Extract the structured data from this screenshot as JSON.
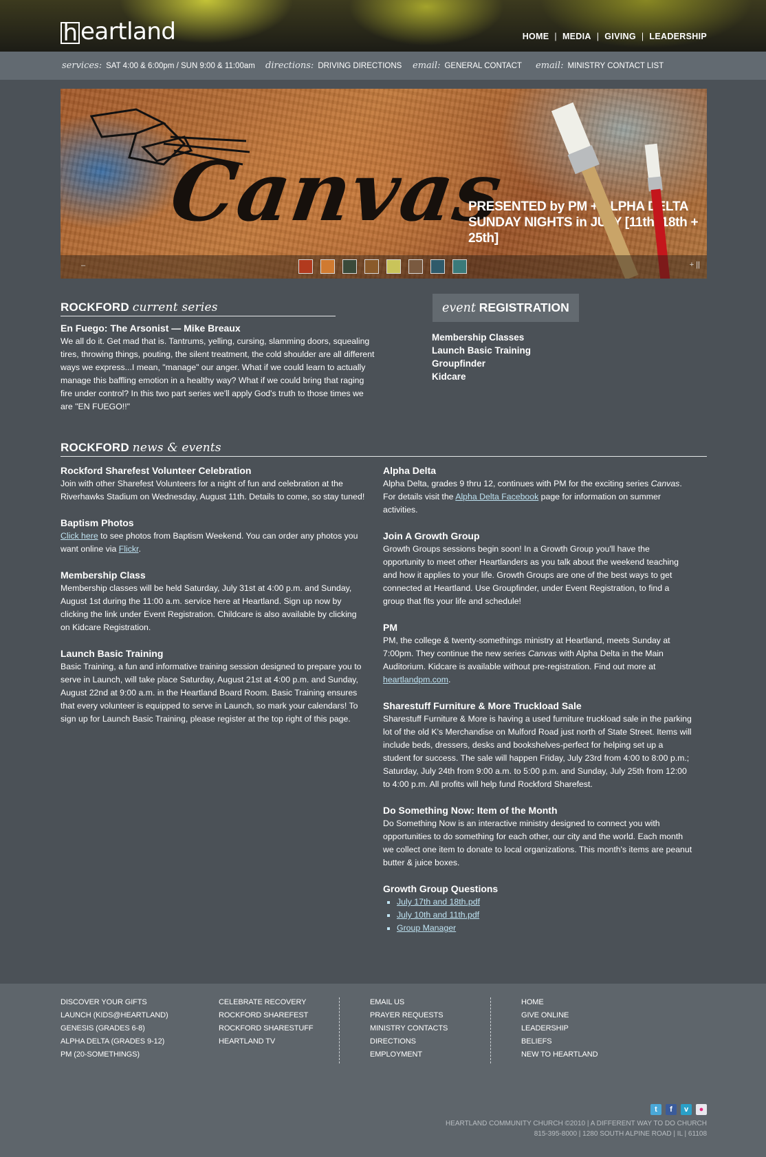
{
  "header": {
    "logo_text": "eartland",
    "logo_initial": "h",
    "nav": [
      "HOME",
      "MEDIA",
      "GIVING",
      "LEADERSHIP"
    ],
    "nav_separator": "|"
  },
  "infobar": {
    "services_label": "services:",
    "services_text": "SAT 4:00 & 6:00pm / SUN 9:00 & 11:00am",
    "directions_label": "directions:",
    "directions_text": "DRIVING DIRECTIONS",
    "email1_label": "email:",
    "email1_text": "GENERAL CONTACT",
    "email2_label": "email:",
    "email2_text": "MINISTRY CONTACT LIST"
  },
  "banner": {
    "title": "Canvas",
    "subtitle_line1": "PRESENTED by PM + ALPHA DELTA",
    "subtitle_line2": "SUNDAY NIGHTS in JULY [11th, 18th + 25th]",
    "thumb_colors": [
      "#b23a1e",
      "#d07a30",
      "#3a4a3a",
      "#8a5a2a",
      "#c9c45a",
      "#7a5a40",
      "#2f5a6a",
      "#3a7a7a"
    ],
    "prev_symbol": "–",
    "next_symbol": "+ ||"
  },
  "series": {
    "heading_bold": "ROCKFORD",
    "heading_script": "current series",
    "title": "En Fuego: The Arsonist — Mike Breaux",
    "body": "We all do it. Get mad that is. Tantrums, yelling, cursing, slamming doors, squealing tires, throwing things, pouting, the silent treatment, the cold shoulder are all different ways we express...I mean, \"manage\" our anger. What if we could learn to actually manage this baffling emotion in a healthy way? What if we could bring that raging fire under control? In this two part series we'll apply God's truth to those times we are \"EN FUEGO!!\""
  },
  "event": {
    "heading_script": "event",
    "heading_bold": "REGISTRATION",
    "links": [
      "Membership Classes",
      "Launch Basic Training",
      "Groupfinder",
      "Kidcare"
    ]
  },
  "news": {
    "heading_bold": "ROCKFORD",
    "heading_script": "news & events",
    "left": [
      {
        "title": "Rockford Sharefest Volunteer Celebration",
        "body": "Join with other Sharefest Volunteers for a night of fun and celebration at the Riverhawks Stadium on Wednesday, August 11th. Details to come, so stay tuned!"
      },
      {
        "title": "Baptism Photos",
        "link1": "Click here",
        "body_mid": " to see photos from Baptism Weekend. You can order any photos you want online via ",
        "link2": "Flickr",
        "body_end": "."
      },
      {
        "title": "Membership Class",
        "body": "Membership classes will be held Saturday, July 31st at 4:00 p.m. and Sunday, August 1st during the 11:00 a.m. service here at Heartland. Sign up now by clicking the link under Event Registration. Childcare is also available by clicking on Kidcare Registration."
      },
      {
        "title": "Launch Basic Training",
        "body": "Basic Training, a fun and informative training session designed to prepare you to serve in Launch, will take place Saturday, August 21st at 4:00 p.m. and Sunday, August 22nd at 9:00 a.m. in the Heartland Board Room. Basic Training ensures that every volunteer is equipped to serve in Launch, so mark your calendars! To sign up for Launch Basic Training, please register at the top right of this page."
      }
    ],
    "right": [
      {
        "title": "Alpha Delta",
        "body_start": "Alpha Delta, grades 9 thru 12, continues with PM for the exciting series ",
        "italic": "Canvas",
        "body_mid": ". For details visit the ",
        "link": "Alpha Delta Facebook",
        "body_end": " page for information on summer activities."
      },
      {
        "title": "Join A Growth Group",
        "body": "Growth Groups sessions begin soon! In a Growth Group you'll have the opportunity to meet other Heartlanders as you talk about the weekend teaching and how it applies to your life. Growth Groups are one of the best ways to get connected at Heartland. Use Groupfinder, under Event Registration, to find a group that fits your life and schedule!"
      },
      {
        "title": "PM",
        "body_start": "PM, the college & twenty-somethings ministry at Heartland, meets Sunday at 7:00pm. They continue the new series ",
        "italic": "Canvas",
        "body_mid": " with Alpha Delta in the Main Auditorium. Kidcare is available without pre-registration. Find out more at ",
        "link": "heartlandpm.com",
        "body_end": "."
      },
      {
        "title": "Sharestuff Furniture & More Truckload Sale",
        "body": "Sharestuff Furniture & More is having a used furniture truckload sale in the parking lot of the old K's Merchandise on Mulford Road just north of State Street. Items will include beds, dressers, desks and bookshelves-perfect for helping set up a student for success. The sale will happen Friday, July 23rd from 4:00 to 8:00 p.m.; Saturday, July 24th from 9:00 a.m. to 5:00 p.m. and Sunday, July 25th from 12:00 to 4:00 p.m. All profits will help fund Rockford Sharefest."
      },
      {
        "title": "Do Something Now: Item of the Month",
        "body": "Do Something Now is an interactive ministry designed to connect you with opportunities to do something for each other, our city and the world. Each month we collect one item to donate to local organizations. This month's items are peanut butter & juice boxes."
      },
      {
        "title": "Growth Group Questions",
        "links": [
          "July 17th and 18th.pdf",
          "July 10th and 11th.pdf",
          "Group Manager"
        ]
      }
    ]
  },
  "footer": {
    "col1": [
      "DISCOVER YOUR GIFTS",
      "LAUNCH (KIDS@HEARTLAND)",
      "GENESIS (GRADES 6-8)",
      "ALPHA DELTA (GRADES 9-12)",
      "PM (20-SOMETHINGS)"
    ],
    "col2": [
      "CELEBRATE RECOVERY",
      "ROCKFORD SHAREFEST",
      "ROCKFORD SHARESTUFF",
      "HEARTLAND TV"
    ],
    "col3": [
      "EMAIL US",
      "PRAYER REQUESTS",
      "MINISTRY CONTACTS",
      "DIRECTIONS",
      "EMPLOYMENT"
    ],
    "col4": [
      "HOME",
      "GIVE ONLINE",
      "LEADERSHIP",
      "BELIEFS",
      "NEW TO HEARTLAND"
    ],
    "social": [
      {
        "icon": "twitter-icon",
        "glyph": "t",
        "color": "#4aa8d8"
      },
      {
        "icon": "facebook-icon",
        "glyph": "f",
        "color": "#3b5b9a"
      },
      {
        "icon": "vimeo-icon",
        "glyph": "v",
        "color": "#2aa0c8"
      },
      {
        "icon": "flickr-icon",
        "glyph": "●",
        "color": "#e8e8ee"
      }
    ],
    "copyright_line1": "HEARTLAND COMMUNITY CHURCH ©2010 | A DIFFERENT WAY TO DO CHURCH",
    "copyright_line2": "815-395-8000 | 1280 SOUTH ALPINE ROAD | IL | 61108"
  }
}
